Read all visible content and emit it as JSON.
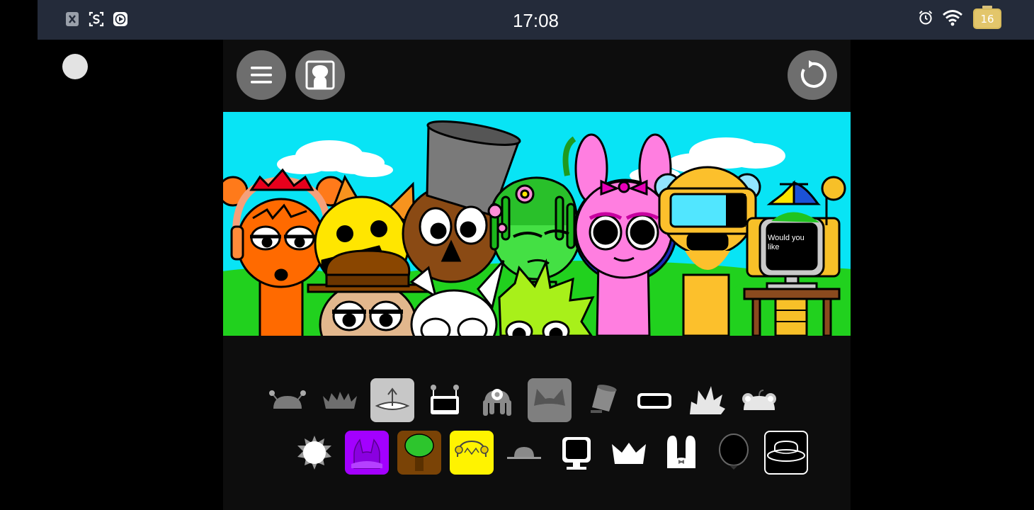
{
  "status_bar": {
    "time": "17:08",
    "battery_level": "16",
    "left_icons": [
      "x-notification-icon",
      "screenshot-icon",
      "media-play-icon"
    ],
    "right_icons": [
      "alarm-icon",
      "wifi-icon",
      "battery-icon"
    ]
  },
  "toolbar": {
    "menu_icon": "menu-icon",
    "avatar_icon": "avatar-icon",
    "reset_icon": "reset-icon"
  },
  "stage": {
    "sky_color": "#08e4f5",
    "grass_color": "#21d11e",
    "speech_text": "Would you like"
  },
  "accessories": {
    "row1": [
      {
        "name": "antenna-helmet",
        "selected": false
      },
      {
        "name": "spiky-crown",
        "selected": false
      },
      {
        "name": "propeller-cap",
        "selected": true,
        "bg": "#c7c7c7"
      },
      {
        "name": "tv-antenna",
        "selected": false
      },
      {
        "name": "flower-dreads",
        "selected": false
      },
      {
        "name": "cat-ears",
        "selected": true,
        "bg": "#7f7f7f"
      },
      {
        "name": "bucket",
        "selected": false
      },
      {
        "name": "visor",
        "selected": false
      },
      {
        "name": "leaf-spikes",
        "selected": false
      },
      {
        "name": "bear-ears",
        "selected": false
      }
    ],
    "row2": [
      {
        "name": "sun",
        "selected": false
      },
      {
        "name": "horns",
        "selected": true,
        "bg": "#a300ff"
      },
      {
        "name": "tree",
        "selected": true,
        "bg": "#7a4306"
      },
      {
        "name": "headphones",
        "selected": true,
        "bg": "#fff300"
      },
      {
        "name": "cap",
        "selected": false
      },
      {
        "name": "monitor",
        "selected": false
      },
      {
        "name": "crown",
        "selected": false
      },
      {
        "name": "bunny-ears",
        "selected": false
      },
      {
        "name": "balloon",
        "selected": false
      },
      {
        "name": "bowler-hat",
        "selected": true,
        "bg": "#000000",
        "border": "#ffffff"
      }
    ]
  }
}
